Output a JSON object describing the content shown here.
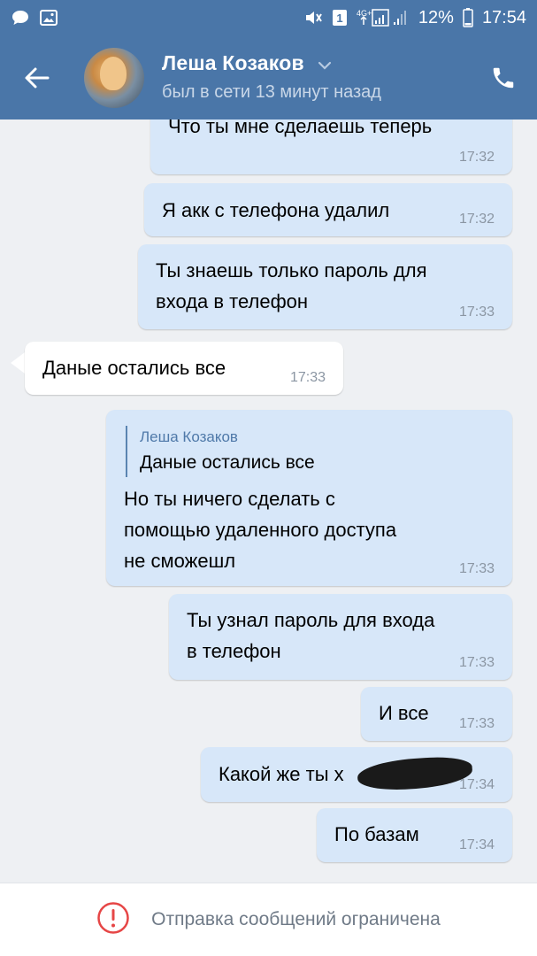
{
  "status_bar": {
    "left_icons": [
      "chat-notification-icon",
      "image-notification-icon"
    ],
    "sim_label": "1",
    "network": "4G+",
    "battery_percent": "12%",
    "time": "17:54"
  },
  "header": {
    "contact_name": "Леша Козаков",
    "last_seen": "был в сети 13 минут назад",
    "icons": [
      "back-arrow-icon",
      "chevron-down-icon",
      "phone-icon"
    ]
  },
  "messages": [
    {
      "direction": "out",
      "text": "Что ты мне сделаешь теперь",
      "time": "17:32"
    },
    {
      "direction": "out",
      "text": "Я акк с телефона удалил",
      "time": "17:32"
    },
    {
      "direction": "out",
      "lines": [
        "Ты знаешь только пароль для",
        "входа в телефон"
      ],
      "time": "17:33"
    },
    {
      "direction": "in",
      "text": "Даные остались все",
      "time": "17:33"
    },
    {
      "direction": "out",
      "reply": {
        "author": "Леша Козаков",
        "text": "Даные остались все"
      },
      "lines": [
        "Но ты ничего сделать с",
        "помощью удаленного доступа",
        "не сможешл"
      ],
      "time": "17:33"
    },
    {
      "direction": "out",
      "lines": [
        "Ты узнал пароль для входа",
        "в телефон"
      ],
      "time": "17:33"
    },
    {
      "direction": "out",
      "text": "И все",
      "time": "17:33"
    },
    {
      "direction": "out",
      "text": "Какой же ты х",
      "time": "17:34",
      "redacted": true
    },
    {
      "direction": "out",
      "text": "По базам",
      "time": "17:34"
    }
  ],
  "footer": {
    "notice": "Отправка сообщений ограничена",
    "icon": "alert-circle-icon",
    "accent_color": "#e64646"
  },
  "colors": {
    "header_bg": "#4a76a8",
    "out_bubble": "#d7e7f9",
    "in_bubble": "#ffffff",
    "chat_bg": "#eef0f3"
  }
}
